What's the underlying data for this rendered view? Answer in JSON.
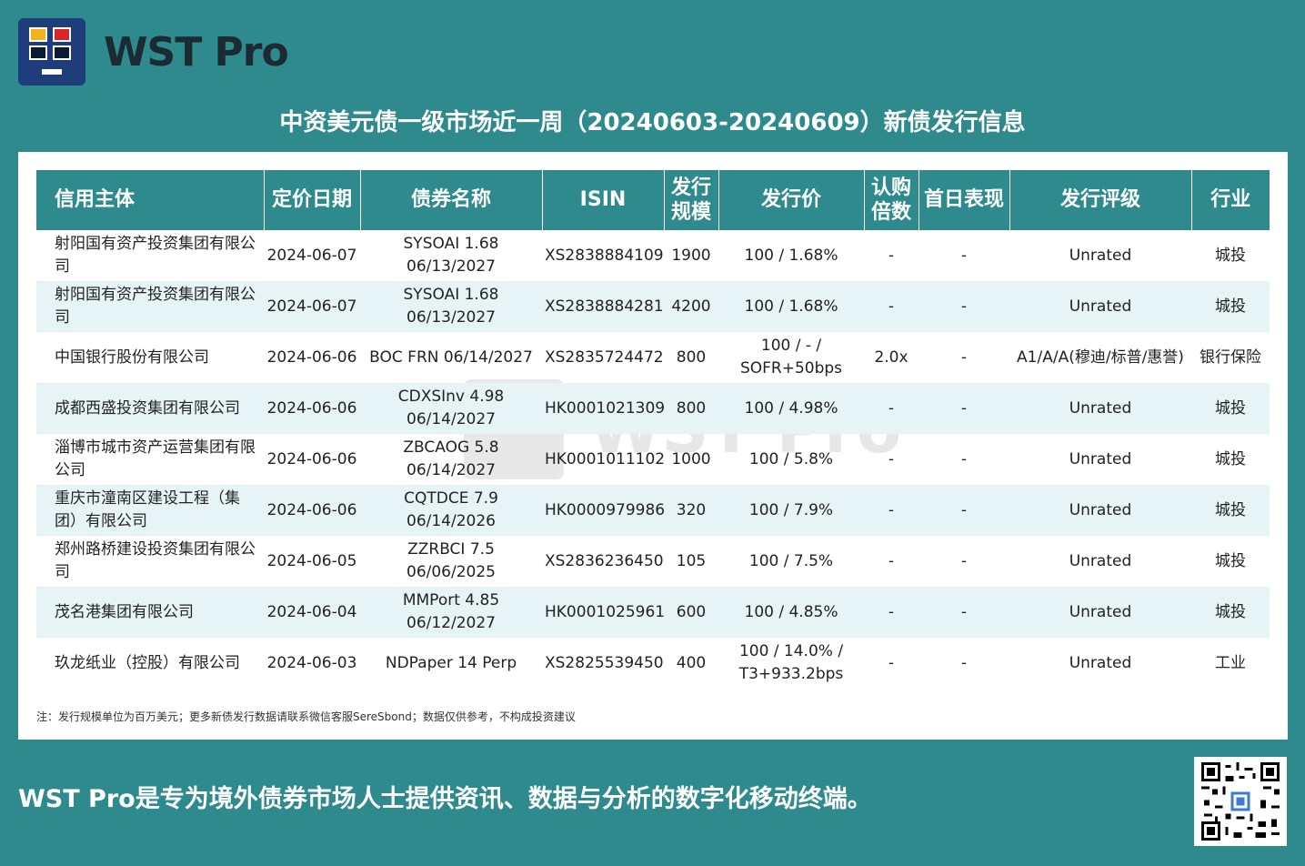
{
  "header": {
    "brand": "WST Pro"
  },
  "title": "中资美元债一级市场近一周（20240603-20240609）新债发行信息",
  "table": {
    "headers": [
      "信用主体",
      "定价日期",
      "债券名称",
      "ISIN",
      "发行规模",
      "发行价",
      "认购倍数",
      "首日表现",
      "发行评级",
      "行业"
    ],
    "rows": [
      [
        "射阳国有资产投资集团有限公司",
        "2024-06-07",
        "SYSOAI 1.68 06/13/2027",
        "XS2838884109",
        "1900",
        "100 / 1.68%",
        "-",
        "-",
        "Unrated",
        "城投"
      ],
      [
        "射阳国有资产投资集团有限公司",
        "2024-06-07",
        "SYSOAI 1.68 06/13/2027",
        "XS2838884281",
        "4200",
        "100 / 1.68%",
        "-",
        "-",
        "Unrated",
        "城投"
      ],
      [
        "中国银行股份有限公司",
        "2024-06-06",
        "BOC FRN 06/14/2027",
        "XS2835724472",
        "800",
        "100 / - / SOFR+50bps",
        "2.0x",
        "-",
        "A1/A/A(穆迪/标普/惠誉)",
        "银行保险"
      ],
      [
        "成都西盛投资集团有限公司",
        "2024-06-06",
        "CDXSInv 4.98 06/14/2027",
        "HK0001021309",
        "800",
        "100 / 4.98%",
        "-",
        "-",
        "Unrated",
        "城投"
      ],
      [
        "淄博市城市资产运营集团有限公司",
        "2024-06-06",
        "ZBCAOG 5.8 06/14/2027",
        "HK0001011102",
        "1000",
        "100 / 5.8%",
        "-",
        "-",
        "Unrated",
        "城投"
      ],
      [
        "重庆市潼南区建设工程（集团）有限公司",
        "2024-06-06",
        "CQTDCE 7.9 06/14/2026",
        "HK0000979986",
        "320",
        "100 / 7.9%",
        "-",
        "-",
        "Unrated",
        "城投"
      ],
      [
        "郑州路桥建设投资集团有限公司",
        "2024-06-05",
        "ZZRBCI 7.5 06/06/2025",
        "XS2836236450",
        "105",
        "100 / 7.5%",
        "-",
        "-",
        "Unrated",
        "城投"
      ],
      [
        "茂名港集团有限公司",
        "2024-06-04",
        "MMPort 4.85 06/12/2027",
        "HK0001025961",
        "600",
        "100 / 4.85%",
        "-",
        "-",
        "Unrated",
        "城投"
      ],
      [
        "玖龙纸业（控股）有限公司",
        "2024-06-03",
        "NDPaper 14 Perp",
        "XS2825539450",
        "400",
        "100 / 14.0% / T3+933.2bps",
        "-",
        "-",
        "Unrated",
        "工业"
      ]
    ]
  },
  "note": "注：发行规模单位为百万美元；更多新债发行数据请联系微信客服SereSbond；数据仅供参考，不构成投资建议",
  "watermark": "WST Pro",
  "footer": "WST Pro是专为境外债券市场人士提供资讯、数据与分析的数字化移动终端。",
  "colors": {
    "background": "#2e8a8c",
    "header_row": "#2e8a8c",
    "alt_row": "#e6f4f6",
    "logo": "#1f3d7a"
  },
  "icons": {
    "logo": "monitor-logo-icon",
    "qr": "qr-code-icon"
  }
}
